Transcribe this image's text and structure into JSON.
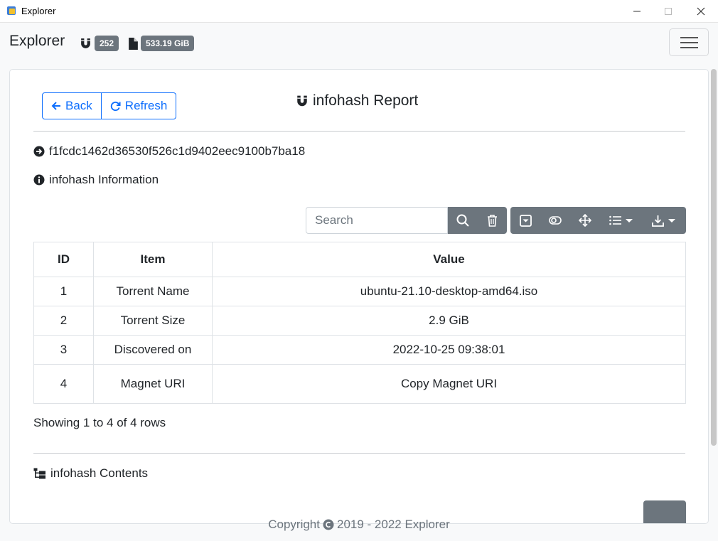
{
  "window": {
    "title": "Explorer"
  },
  "navbar": {
    "brand": "Explorer",
    "infohash_count": "252",
    "total_size": "533.19 GiB"
  },
  "toolbar": {
    "back_label": "Back",
    "refresh_label": "Refresh"
  },
  "report": {
    "title": "infohash Report",
    "hash": "f1fcdc1462d36530f526c1d9402eec9100b7ba18",
    "info_heading": "infohash Information",
    "contents_heading": "infohash Contents"
  },
  "table": {
    "search_placeholder": "Search",
    "headers": [
      "ID",
      "Item",
      "Value"
    ],
    "rows": [
      {
        "id": "1",
        "item": "Torrent Name",
        "value": "ubuntu-21.10-desktop-amd64.iso"
      },
      {
        "id": "2",
        "item": "Torrent Size",
        "value": "2.9 GiB"
      },
      {
        "id": "3",
        "item": "Discovered on",
        "value": "2022-10-25 09:38:01"
      },
      {
        "id": "4",
        "item": "Magnet URI",
        "value": "Copy Magnet URI"
      }
    ],
    "rows_info": "Showing 1 to 4 of 4 rows"
  },
  "footer": {
    "prefix": "Copyright",
    "years": "2019 - 2022 Explorer"
  },
  "colors": {
    "accent": "#0d6efd",
    "secondary": "#6c757d"
  },
  "icons": [
    "magnet-icon",
    "file-icon",
    "arrow-left-icon",
    "refresh-icon",
    "arrow-circle-right-icon",
    "info-circle-icon",
    "search-icon",
    "trash-icon",
    "caret-square-icon",
    "toggle-icon",
    "arrows-move-icon",
    "list-icon",
    "download-icon",
    "sitemap-icon",
    "copyright-icon"
  ]
}
